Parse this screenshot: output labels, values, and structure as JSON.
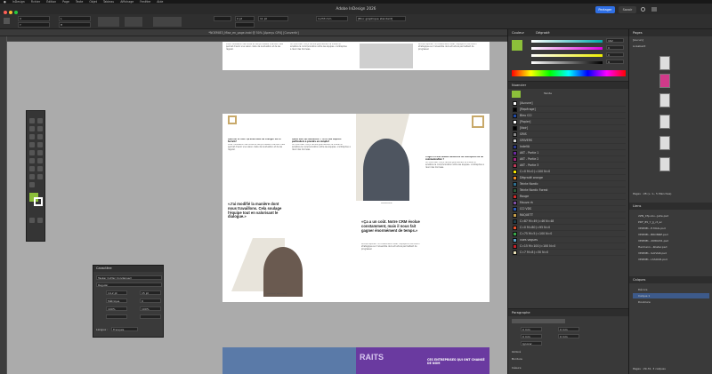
{
  "menubar": {
    "items": [
      "InDesign",
      "Fichier",
      "Édition",
      "Page",
      "Texte",
      "Objet",
      "Tableau",
      "Affichage",
      "Fenêtre",
      "Aide"
    ]
  },
  "titlebar": {
    "title": "Adobe InDesign 2026"
  },
  "header": {
    "share_label": "Partager",
    "savoir_label": "Savoir"
  },
  "control": {
    "font_size": "11 pt",
    "zoom": "4,233 mm",
    "style": "[Bloc graphique standard]",
    "stroke": "0 pt"
  },
  "document": {
    "tab_title": "*NOEMIE3_Mise_en_page.indd @ 50% [Aperçu GPU] [Convertir]"
  },
  "spread": {
    "left_page_quote": "«J'ai modifié la manière dont nous travaillons. Cela soulage l'équipe tout en valorisant le dialogue.»",
    "right_page_quote": "«Ça a un coût. Notre CRM évolue constamment, mais il nous fait gagner énormément de temps.»",
    "bottom_banner": "CES ENTREPRISES QUI ONT CHANGÉ DE NOM",
    "bottom_banner_letters": "RAITS"
  },
  "character_panel": {
    "title": "Caractère",
    "font": "Tasker Cutter Condensed",
    "style": "Regular",
    "size": "14,2 pt",
    "leading": "15 pt",
    "kerning": "Métrique",
    "tracking": "0",
    "scale_v": "100%",
    "scale_h": "100%",
    "language": "Français"
  },
  "color_panel": {
    "tabs": [
      "Couleur",
      "Dégradé"
    ],
    "values": [
      "162",
      "0",
      "0",
      "9"
    ]
  },
  "swatches": {
    "title": "Nuancier",
    "tint": "Teinte",
    "items": [
      {
        "name": "[Aucune]",
        "color": "#ffffff"
      },
      {
        "name": "[Repérage]",
        "color": "#000000"
      },
      {
        "name": "Bleu CCI",
        "color": "#1f4aa8"
      },
      {
        "name": "[Papier]",
        "color": "#ffffff"
      },
      {
        "name": "[Noir]",
        "color": "#000000"
      },
      {
        "name": "GRIS",
        "color": "#8a8a8a"
      },
      {
        "name": "GRIVERS",
        "color": "#cfcfcf"
      },
      {
        "name": "IndeVA",
        "color": "#2b3a8f"
      },
      {
        "name": "AKT - Partie 1",
        "color": "#6d2aa0"
      },
      {
        "name": "AKT - Partie 2",
        "color": "#a0267d"
      },
      {
        "name": "AKT - Partie 3",
        "color": "#c03a5a"
      },
      {
        "name": "C=0 M=0 J=100 N=0",
        "color": "#f2e600"
      },
      {
        "name": "Dégradé orange",
        "color": "#e88a2a"
      },
      {
        "name": "Teinte Nordic",
        "color": "#2f6f8f"
      },
      {
        "name": "Teinte Nordic Forest",
        "color": "#2d5a3a"
      },
      {
        "name": "Rouge",
        "color": "#d32a2a"
      },
      {
        "name": "Mauve rh",
        "color": "#7e4ea3"
      },
      {
        "name": "CCI VDS",
        "color": "#2c5cb8"
      },
      {
        "name": "RAQUETT",
        "color": "#c8a04a"
      },
      {
        "name": "C=87 M=49 J=46 N=48",
        "color": "#1f3e4a"
      },
      {
        "name": "C=0 M=80 J=95 N=0",
        "color": "#e8502a"
      },
      {
        "name": "C=75 M=5 J=100 N=0",
        "color": "#3aa84a"
      },
      {
        "name": "vues vagues",
        "color": "#5aa0c8"
      },
      {
        "name": "C=15 M=100 J=100 N=0",
        "color": "#c8202a"
      },
      {
        "name": "C=7 M=8 J=30 N=0",
        "color": "#eae0b8"
      }
    ]
  },
  "paragraph_panel": {
    "title": "Paragraphe",
    "indent_left": "0 mm",
    "indent_right": "0 mm",
    "space_before": "0 mm",
    "space_after": "0 mm",
    "align": "Ignorer",
    "hyphen_label": "Césure",
    "shading_label": "Ombré",
    "border_label": "Bordure",
    "hyphenation": "Césure"
  },
  "pages_panel": {
    "title": "Pages",
    "none_label": "[Aucun]",
    "master": "A-Gabarit",
    "pages_count": "Pages : 28 (+ 1-, 5 Planches)",
    "layers_title": "Liens",
    "links": [
      "2ZN_Cfp-Alu...Jalle.psd",
      "PDF_85_Y_Jj_ct_ec",
      "VERMEI...E.MAIL.psd",
      "VERMEI...BRONNE.psd",
      "VERMEI...2080201.psd",
      "Hermann...Roster.psd",
      "VERMEI...SAHARI.psd",
      "VERMEI...LSSOUR.psd"
    ]
  },
  "layers": {
    "title": "Calques",
    "items": [
      "Décors",
      "Calque 1",
      "Doublure"
    ],
    "footer": "Pages : 29-31, 3 calques"
  },
  "doc_snippets": {
    "p1": "Voilà l'utilisation des outils et des processus internes. Cela permet d'avoir une vision claire de la situation et de les réguler.",
    "p2": "Un CRM bien conçu facilite grandement le travail et améliore la communication entre les équipes. L'entreprise a réuni des données.",
    "p3": "Bonne réponse : la collaboration avec l'équipe et une vision stratégique sur l'ensemble de la structure permettent de progresser.",
    "title_a": "Quel est le rôle? Qu'avez-vous dû changer sur le terrain?",
    "title_b": "Quels sont les obstacles? Y a-t-il des aspects particuliers à prendre en compte?",
    "title_c": "S'agit-il d'une double démarche de conception ou de communication ?",
    "caption_a": "GUILLAUME",
    "caption_b": "LAURENT GENTHON"
  }
}
